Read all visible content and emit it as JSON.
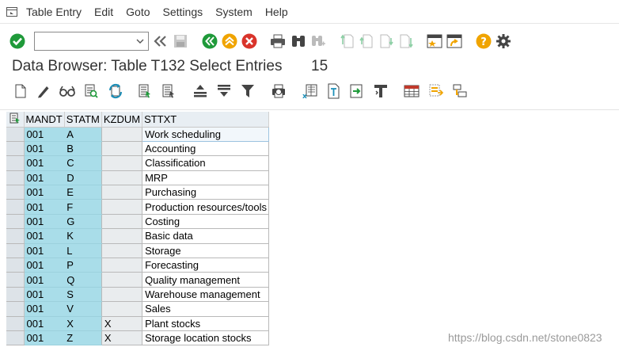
{
  "menu": {
    "items": [
      "Table Entry",
      "Edit",
      "Goto",
      "Settings",
      "System",
      "Help"
    ]
  },
  "toolbar": {
    "command_value": "",
    "icons": [
      "enter-icon",
      "back-icon",
      "exit-icon",
      "cancel-icon",
      "print-icon",
      "find-icon",
      "find-next-icon",
      "first-page-icon",
      "previous-page-icon",
      "next-page-icon",
      "last-page-icon",
      "create-session-icon",
      "shortcut-icon",
      "help-icon",
      "customize-icon"
    ]
  },
  "title": {
    "text": "Data Browser: Table T132 Select Entries",
    "count": "15"
  },
  "app_toolbar": {
    "icons": [
      "create-icon",
      "change-icon",
      "display-icon",
      "check-table-icon",
      "refresh-icon",
      "select-all-icon",
      "choose-icon",
      "sort-icon",
      "filter-icon",
      "selection-criteria-icon",
      "print-preview-icon",
      "export-excel-icon",
      "word-processing-icon",
      "local-file-icon",
      "abc-analysis-icon",
      "grid-layout-icon",
      "choose-layout-icon",
      "save-layout-icon"
    ]
  },
  "table": {
    "columns": [
      "MANDT",
      "STATM",
      "KZDUM",
      "STTXT"
    ],
    "rows": [
      [
        "001",
        "A",
        "",
        "Work scheduling"
      ],
      [
        "001",
        "B",
        "",
        "Accounting"
      ],
      [
        "001",
        "C",
        "",
        "Classification"
      ],
      [
        "001",
        "D",
        "",
        "MRP"
      ],
      [
        "001",
        "E",
        "",
        "Purchasing"
      ],
      [
        "001",
        "F",
        "",
        "Production resources/tools"
      ],
      [
        "001",
        "G",
        "",
        "Costing"
      ],
      [
        "001",
        "K",
        "",
        "Basic data"
      ],
      [
        "001",
        "L",
        "",
        "Storage"
      ],
      [
        "001",
        "P",
        "",
        "Forecasting"
      ],
      [
        "001",
        "Q",
        "",
        "Quality management"
      ],
      [
        "001",
        "S",
        "",
        "Warehouse management"
      ],
      [
        "001",
        "V",
        "",
        "Sales"
      ],
      [
        "001",
        "X",
        "X",
        "Plant stocks"
      ],
      [
        "001",
        "Z",
        "X",
        "Storage location stocks"
      ]
    ]
  },
  "watermark": "https://blog.csdn.net/stone0823",
  "colors": {
    "key_cell": "#a9dde9",
    "enter_green": "#1f9a3a",
    "cancel_red": "#d9342b",
    "help_orange": "#f0a400"
  }
}
